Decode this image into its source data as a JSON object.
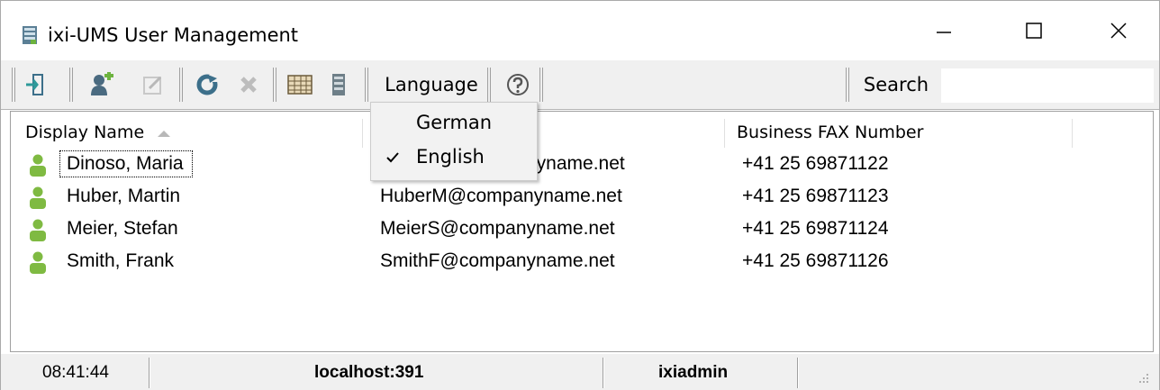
{
  "window": {
    "title": "ixi-UMS User Management"
  },
  "toolbar": {
    "language_label": "Language",
    "search_label": "Search",
    "search_value": ""
  },
  "language_menu": {
    "items": [
      {
        "label": "German",
        "checked": false
      },
      {
        "label": "English",
        "checked": true
      }
    ]
  },
  "list": {
    "columns": [
      "Display Name",
      "",
      "Business FAX Number"
    ],
    "sort_column": "Display Name",
    "sort_direction": "ascending",
    "rows": [
      {
        "name": "Dinoso, Maria",
        "email": "nyname.net",
        "fax": "+41 25 69871122"
      },
      {
        "name": "Huber, Martin",
        "email": "HuberM@companyname.net",
        "fax": "+41 25 69871123"
      },
      {
        "name": "Meier, Stefan",
        "email": "MeierS@companyname.net",
        "fax": "+41 25 69871124"
      },
      {
        "name": "Smith, Frank",
        "email": "SmithF@companyname.net",
        "fax": "+41 25 69871126"
      }
    ]
  },
  "statusbar": {
    "time": "08:41:44",
    "server": "localhost:391",
    "user": "ixiadmin"
  },
  "colors": {
    "user_icon": "#7fba42",
    "toolbar_bg": "#f0f0f0"
  }
}
